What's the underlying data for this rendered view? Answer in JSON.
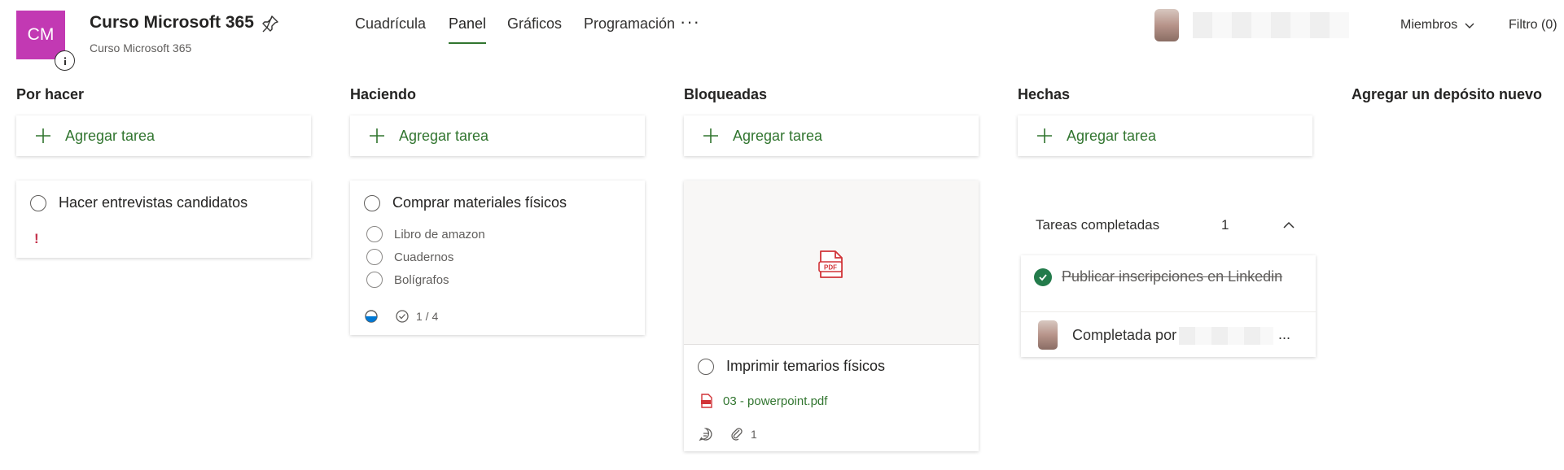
{
  "header": {
    "avatar_initials": "CM",
    "plan_title": "Curso Microsoft 365",
    "plan_subtitle": "Curso Microsoft 365",
    "nav_tabs": [
      {
        "label": "Cuadrícula",
        "active": false
      },
      {
        "label": "Panel",
        "active": true
      },
      {
        "label": "Gráficos",
        "active": false
      },
      {
        "label": "Programación",
        "active": false
      }
    ],
    "more_label": "···",
    "members_label": "Miembros",
    "filter_label": "Filtro (0)"
  },
  "columns": [
    {
      "title": "Por hacer",
      "add_label": "Agregar tarea"
    },
    {
      "title": "Haciendo",
      "add_label": "Agregar tarea"
    },
    {
      "title": "Bloqueadas",
      "add_label": "Agregar tarea"
    },
    {
      "title": "Hechas",
      "add_label": "Agregar tarea"
    }
  ],
  "add_bucket_label": "Agregar un depósito nuevo",
  "tasks": {
    "todo": {
      "title": "Hacer entrevistas candidatos",
      "priority": "!"
    },
    "doing": {
      "title": "Comprar materiales físicos",
      "checklist": [
        "Libro de amazon",
        "Cuadernos",
        "Bolígrafos"
      ],
      "checklist_progress": "1 / 4"
    },
    "blocked": {
      "title": "Imprimir temarios físicos",
      "attachment": "03 - powerpoint.pdf",
      "attachment_count": "1"
    },
    "done": {
      "completed_header": "Tareas completadas",
      "completed_count": "1",
      "title": "Publicar inscripciones en Linkedin",
      "completed_by": "Completada por",
      "ellipsis": "..."
    }
  },
  "colors": {
    "accent_green": "#31752f",
    "plan_avatar": "#c239b3",
    "priority_red": "#c4314b",
    "pdf_red": "#d13438"
  }
}
